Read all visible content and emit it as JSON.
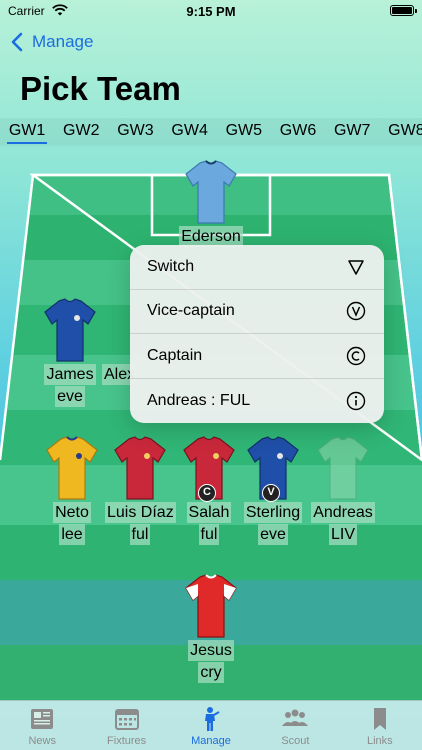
{
  "status_bar": {
    "carrier": "Carrier",
    "time": "9:15 PM"
  },
  "nav": {
    "back_label": "Manage",
    "title": "Pick Team"
  },
  "gameweeks": [
    "GW1",
    "GW2",
    "GW3",
    "GW4",
    "GW5",
    "GW6",
    "GW7",
    "GW8"
  ],
  "active_gameweek": "GW1",
  "players": {
    "gk": {
      "name": "Ederson"
    },
    "def1": {
      "name": "James",
      "team": "eve"
    },
    "def2": {
      "name": "Alex"
    },
    "mid1": {
      "name": "Neto",
      "team": "lee"
    },
    "mid2": {
      "name": "Luis Díaz",
      "team": "ful"
    },
    "mid3": {
      "name": "Salah",
      "team": "ful",
      "badge": "C"
    },
    "mid4": {
      "name": "Sterling",
      "team": "eve",
      "badge": "V"
    },
    "mid5": {
      "name": "Andreas",
      "team": "LIV"
    },
    "fwd1": {
      "name": "Jesus",
      "team": "cry"
    }
  },
  "context_menu": {
    "items": [
      {
        "label": "Switch",
        "icon": "triangle-icon"
      },
      {
        "label": "Vice-captain",
        "icon": "v-circle-icon"
      },
      {
        "label": "Captain",
        "icon": "c-circle-icon"
      },
      {
        "label": "Andreas : FUL",
        "icon": "info-circle-icon"
      }
    ]
  },
  "tab_bar": {
    "items": [
      {
        "label": "News",
        "icon": "newspaper-icon"
      },
      {
        "label": "Fixtures",
        "icon": "calendar-icon"
      },
      {
        "label": "Manage",
        "icon": "person-icon"
      },
      {
        "label": "Scout",
        "icon": "people-icon"
      },
      {
        "label": "Links",
        "icon": "bookmark-icon"
      }
    ],
    "active": "Manage"
  },
  "colors": {
    "accent": "#1a6de0",
    "pitch_light": "#4fc38a",
    "pitch_dark": "#2fb071",
    "shirt_sky": "#6aa8de",
    "shirt_navy": "#1f4fa8",
    "shirt_red": "#c8283a",
    "shirt_yellow": "#f0b820",
    "shirt_green": "#8fd8b0"
  }
}
